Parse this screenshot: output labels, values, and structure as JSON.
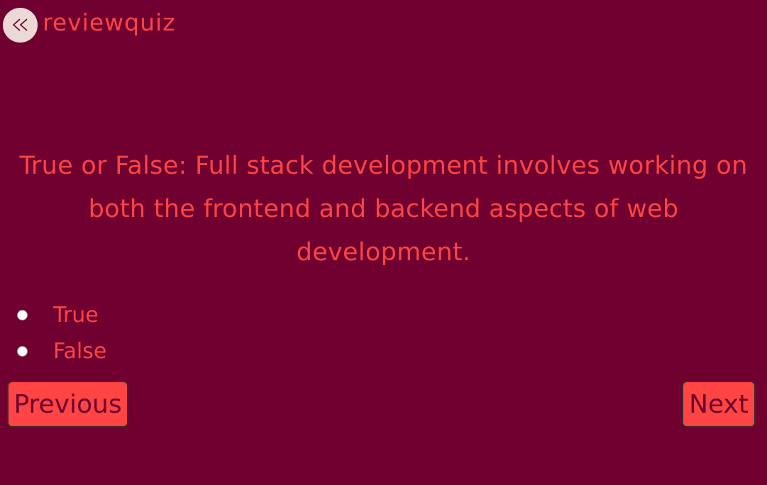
{
  "header": {
    "back_icon": "double-chevron-left-icon",
    "title": "reviewquiz"
  },
  "question": {
    "text": "True or False: Full stack development involves working on both the frontend and backend aspects of web development."
  },
  "options": [
    {
      "label": "True",
      "selected": false
    },
    {
      "label": "False",
      "selected": false
    }
  ],
  "navigation": {
    "previous_label": "Previous",
    "next_label": "Next"
  },
  "colors": {
    "background": "#700030",
    "accent": "#ff4444",
    "back_button_bg": "#ecd9d6"
  }
}
